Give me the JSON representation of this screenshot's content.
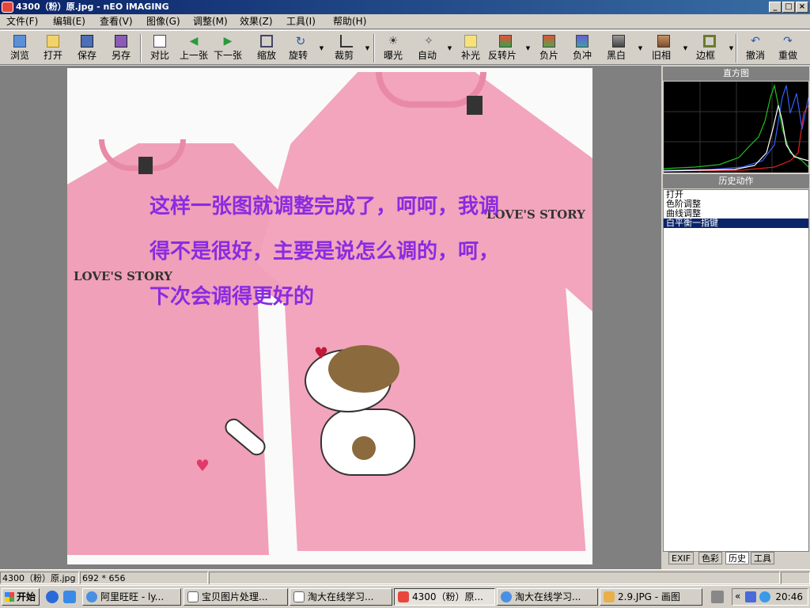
{
  "title": "4300（粉）原.jpg - nEO iMAGING",
  "window_buttons": {
    "min": "_",
    "max": "□",
    "close": "×"
  },
  "menu": [
    "文件(F)",
    "编辑(E)",
    "查看(V)",
    "图像(G)",
    "调整(M)",
    "效果(Z)",
    "工具(I)",
    "帮助(H)"
  ],
  "toolbar": {
    "browse": "浏览",
    "open": "打开",
    "save": "保存",
    "save_as": "另存",
    "compare": "对比",
    "prev": "上一张",
    "next": "下一张",
    "zoom": "缩放",
    "rotate": "旋转",
    "crop": "裁剪",
    "exposure": "曝光",
    "auto": "自动",
    "fill_light": "补光",
    "reverse": "反转片",
    "negative": "负片",
    "neg_cross": "负冲",
    "bw": "黑白",
    "old": "旧相",
    "border": "边框",
    "undo": "撤消",
    "redo": "重做"
  },
  "image": {
    "overlay_text": "这样一张图就调整完成了，呵呵，我调得不是很好，主要是说怎么调的，呵，下次会调得更好的",
    "shirt_brand": "LOVE'S STORY"
  },
  "panel": {
    "histogram_title": "直方图",
    "history_title": "历史动作",
    "history_items": [
      "打开",
      "色阶调整",
      "曲线调整",
      "白平衡一指键"
    ],
    "tabs": [
      "EXIF",
      "色彩",
      "历史",
      "工具"
    ]
  },
  "status": {
    "filename": "4300（粉）原.jpg",
    "dims": "692 * 656"
  },
  "taskbar": {
    "start": "开始",
    "tasks": [
      "阿里旺旺 - ly...",
      "宝贝图片处理...",
      "淘大在线学习...",
      "4300（粉）原...",
      "淘大在线学习...",
      "2.9.JPG - 画图"
    ],
    "tray_arrow": "«",
    "clock": "20:46"
  }
}
